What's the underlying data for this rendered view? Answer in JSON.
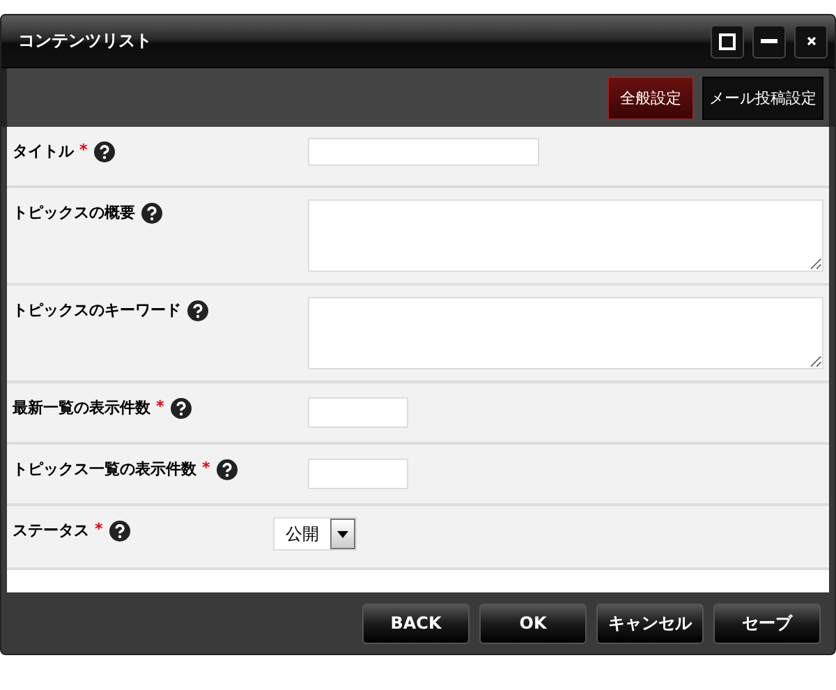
{
  "window": {
    "title": "コンテンツリスト"
  },
  "toolbar": [
    {
      "label": "全般設定",
      "selected": true
    },
    {
      "label": "メール投稿設定",
      "selected": false
    }
  ],
  "fields": [
    {
      "label": "タイトル",
      "required": true,
      "kind": "text"
    },
    {
      "label": "トピックスの概要",
      "required": false,
      "kind": "textarea"
    },
    {
      "label": "トピックスのキーワード",
      "required": false,
      "kind": "textarea"
    },
    {
      "label": "最新一覧の表示件数",
      "required": true,
      "kind": "short"
    },
    {
      "label": "トピックス一覧の表示件数",
      "required": true,
      "kind": "short"
    },
    {
      "label": "ステータス",
      "required": true,
      "kind": "select",
      "value": "公開"
    }
  ],
  "required_mark": "*",
  "buttons": [
    "BACK",
    "OK",
    "キャンセル",
    "セーブ"
  ]
}
